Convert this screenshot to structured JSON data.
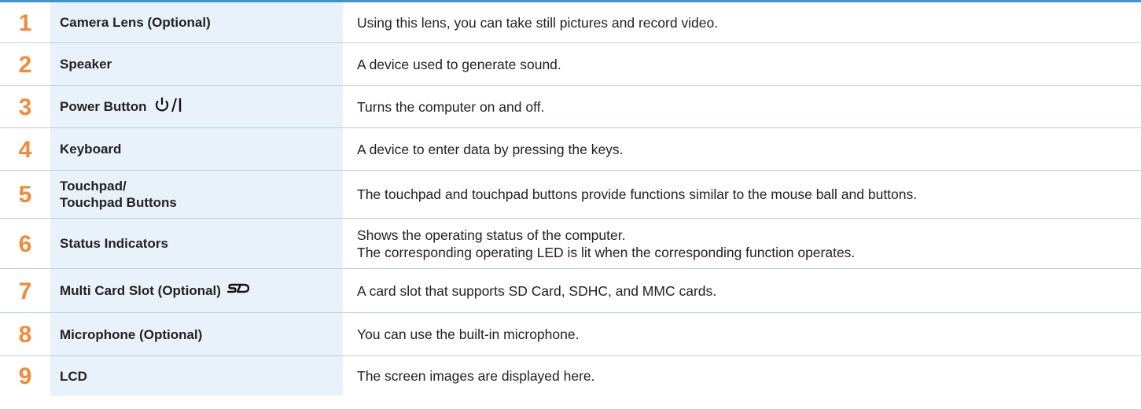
{
  "colors": {
    "accent_rule": "#3d95d1",
    "number_color": "#f28a3c",
    "name_cell_bg": "#e9f2fa",
    "row_divider": "#b9cfe1"
  },
  "rows": [
    {
      "number": "1",
      "name": "Camera Lens (Optional)",
      "description": "Using this lens, you can take still pictures and record video."
    },
    {
      "number": "2",
      "name": "Speaker",
      "description": "A device used to generate sound."
    },
    {
      "number": "3",
      "name": "Power Button",
      "name_icon": "power-icon",
      "description": "Turns the computer on and off."
    },
    {
      "number": "4",
      "name": "Keyboard",
      "description": "A device to enter data by pressing the keys."
    },
    {
      "number": "5",
      "name": "Touchpad/\nTouchpad Buttons",
      "description": "The touchpad and touchpad buttons provide functions similar to the mouse ball and buttons."
    },
    {
      "number": "6",
      "name": "Status Indicators",
      "description": "Shows the operating status of the computer.\nThe corresponding operating LED is lit when the corresponding function operates."
    },
    {
      "number": "7",
      "name": "Multi Card Slot (Optional)",
      "name_icon": "sd-card-icon",
      "description": "A card slot that supports SD Card, SDHC, and MMC cards."
    },
    {
      "number": "8",
      "name": "Microphone (Optional)",
      "description": "You can use the built-in microphone."
    },
    {
      "number": "9",
      "name": "LCD",
      "description": "The screen images are displayed here."
    }
  ]
}
